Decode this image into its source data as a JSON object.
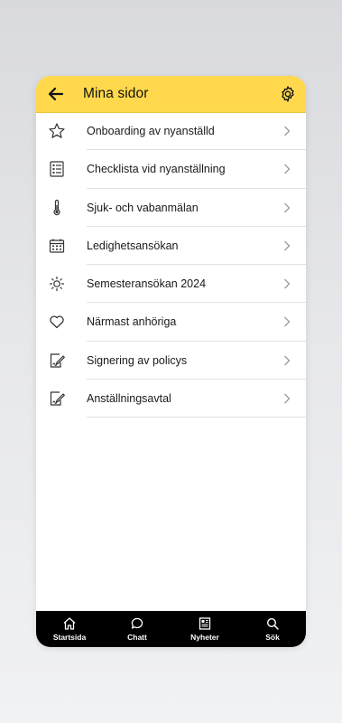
{
  "header": {
    "title": "Mina sidor"
  },
  "menu": [
    {
      "label": "Onboarding av nyanställd",
      "icon": "star-icon"
    },
    {
      "label": "Checklista vid nyanställning",
      "icon": "checklist-icon"
    },
    {
      "label": "Sjuk- och vabanmälan",
      "icon": "thermometer-icon"
    },
    {
      "label": "Ledighetsansökan",
      "icon": "calendar-icon"
    },
    {
      "label": "Semesteransökan 2024",
      "icon": "sun-icon"
    },
    {
      "label": "Närmast anhöriga",
      "icon": "heart-icon"
    },
    {
      "label": "Signering av policys",
      "icon": "sign-document-icon"
    },
    {
      "label": "Anställningsavtal",
      "icon": "sign-document-icon"
    }
  ],
  "nav": [
    {
      "label": "Startsida",
      "icon": "home-icon"
    },
    {
      "label": "Chatt",
      "icon": "chat-icon"
    },
    {
      "label": "Nyheter",
      "icon": "news-icon"
    },
    {
      "label": "Sök",
      "icon": "search-icon"
    }
  ]
}
